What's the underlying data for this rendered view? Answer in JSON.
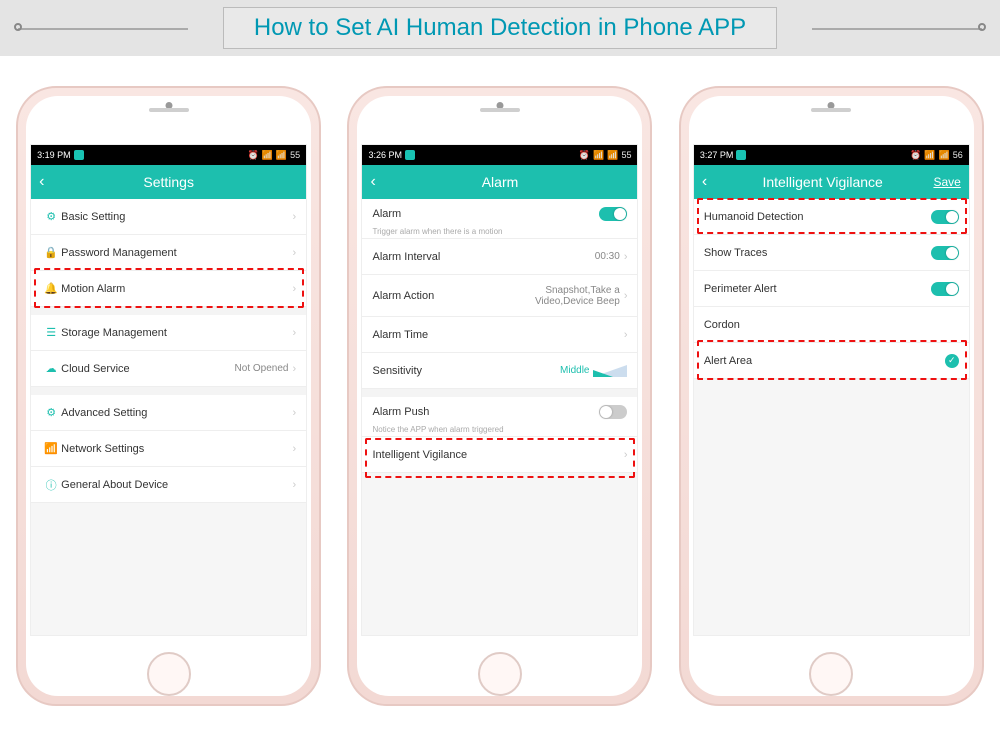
{
  "banner": {
    "title": "How to Set AI Human Detection in Phone APP"
  },
  "phone1": {
    "status_time": "3:19 PM",
    "header": "Settings",
    "rows": [
      {
        "icon": "gear",
        "label": "Basic Setting"
      },
      {
        "icon": "lock",
        "label": "Password Management"
      },
      {
        "icon": "bell",
        "label": "Motion Alarm"
      },
      {
        "icon": "db",
        "label": "Storage Management"
      },
      {
        "icon": "cloud",
        "label": "Cloud Service",
        "value": "Not Opened"
      },
      {
        "icon": "sliders",
        "label": "Advanced Setting"
      },
      {
        "icon": "wifi",
        "label": "Network Settings"
      },
      {
        "icon": "info",
        "label": "General About Device"
      }
    ]
  },
  "phone2": {
    "status_time": "3:26 PM",
    "header": "Alarm",
    "alarm": {
      "title": "Alarm",
      "sub": "Trigger alarm when there is a motion",
      "toggle": true
    },
    "interval": {
      "label": "Alarm Interval",
      "value": "00:30"
    },
    "action": {
      "label": "Alarm Action",
      "value": "Snapshot,Take a Video,Device Beep"
    },
    "time": {
      "label": "Alarm Time"
    },
    "sensitivity": {
      "label": "Sensitivity",
      "value": "Middle"
    },
    "push": {
      "label": "Alarm Push",
      "sub": "Notice the APP when alarm triggered",
      "toggle": false
    },
    "iv": {
      "label": "Intelligent Vigilance"
    }
  },
  "phone3": {
    "status_time": "3:27 PM",
    "header": "Intelligent Vigilance",
    "save": "Save",
    "rows": {
      "humanoid": {
        "label": "Humanoid Detection",
        "toggle": true
      },
      "traces": {
        "label": "Show Traces",
        "toggle": true
      },
      "perimeter": {
        "label": "Perimeter Alert",
        "toggle": true
      },
      "cordon": {
        "label": "Cordon"
      },
      "alert": {
        "label": "Alert Area",
        "checked": true
      }
    }
  },
  "status_icons": {
    "battery": "55",
    "battery2": "56"
  }
}
